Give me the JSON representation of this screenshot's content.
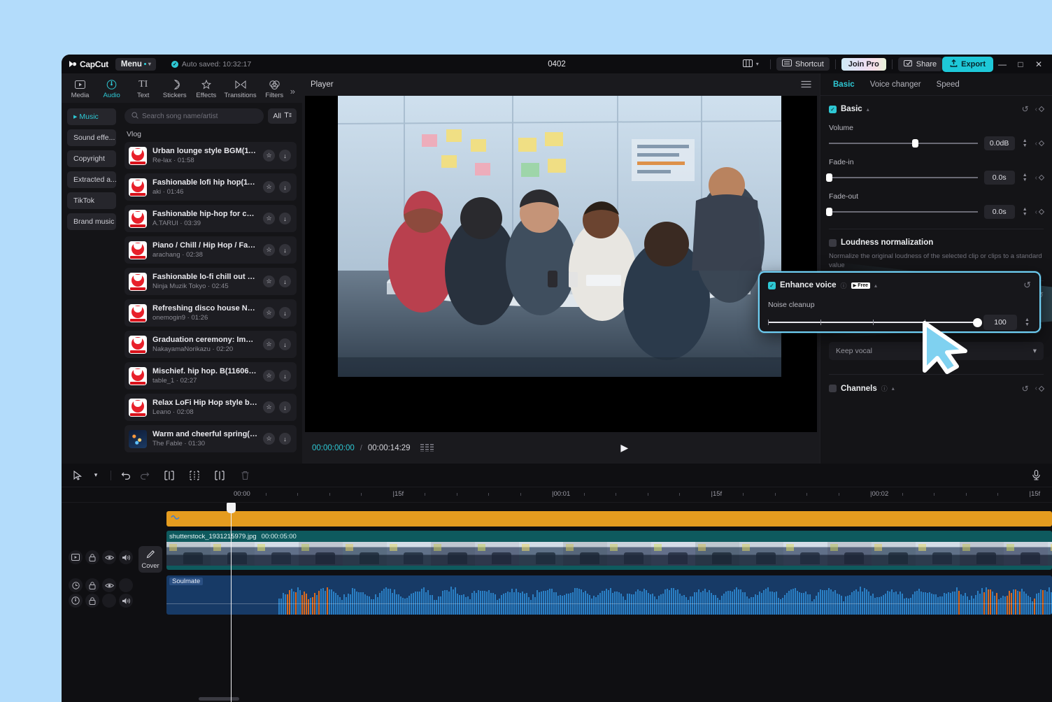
{
  "titlebar": {
    "app_name": "CapCut",
    "menu_label": "Menu",
    "autosave": "Auto saved: 10:32:17",
    "project_title": "0402",
    "shortcut_label": "Shortcut",
    "join_pro_label": "Join Pro",
    "share_label": "Share",
    "export_label": "Export",
    "minimize": "—",
    "maximize": "□",
    "close": "✕",
    "accent": "#1ec8d8"
  },
  "left_panel": {
    "tabs": [
      {
        "label": "Media",
        "icon": "media-icon"
      },
      {
        "label": "Audio",
        "icon": "audio-icon"
      },
      {
        "label": "Text",
        "icon": "text-icon"
      },
      {
        "label": "Stickers",
        "icon": "stickers-icon"
      },
      {
        "label": "Effects",
        "icon": "effects-icon"
      },
      {
        "label": "Transitions",
        "icon": "transitions-icon"
      },
      {
        "label": "Filters",
        "icon": "filters-icon"
      }
    ],
    "more_label": "»",
    "categories": [
      {
        "label": "Music",
        "active": true
      },
      {
        "label": "Sound effe...",
        "active": false
      },
      {
        "label": "Copyright",
        "active": false
      },
      {
        "label": "Extracted a...",
        "active": false
      },
      {
        "label": "TikTok",
        "active": false
      },
      {
        "label": "Brand music",
        "active": false
      }
    ],
    "search_placeholder": "Search song name/artist",
    "filter_label": "All",
    "section_title": "Vlog",
    "songs": [
      {
        "name": "Urban lounge style BGM(114...",
        "artist": "Re-lax",
        "duration": "01:58"
      },
      {
        "name": "Fashionable lofi hip hop(116...",
        "artist": "aki",
        "duration": "01:46"
      },
      {
        "name": "Fashionable hip-hop for com...",
        "artist": "A.TARUI",
        "duration": "03:39"
      },
      {
        "name": "Piano / Chill / Hip Hop / Fas...",
        "artist": "arachang",
        "duration": "02:38"
      },
      {
        "name": "Fashionable lo-fi chill out R ...",
        "artist": "Ninja Muzik Tokyo",
        "duration": "02:45"
      },
      {
        "name": "Refreshing disco house Nori ...",
        "artist": "onemogin9",
        "duration": "01:26"
      },
      {
        "name": "Graduation ceremony: Impre...",
        "artist": "NakayamaNorikazu",
        "duration": "02:20"
      },
      {
        "name": "Mischief. hip hop. B(1160627)",
        "artist": "table_1",
        "duration": "02:27"
      },
      {
        "name": "Relax LoFi Hip Hop style bea...",
        "artist": "Leano",
        "duration": "02:08"
      },
      {
        "name": "Warm and cheerful spring(14...",
        "artist": "The Fable",
        "duration": "01:30"
      }
    ]
  },
  "player": {
    "title": "Player",
    "current_time": "00:00:00:00",
    "separator": "/",
    "total_time": "00:00:14:29",
    "play_icon": "▶"
  },
  "right_panel": {
    "tabs": [
      {
        "label": "Basic",
        "active": true
      },
      {
        "label": "Voice changer",
        "active": false
      },
      {
        "label": "Speed",
        "active": false
      }
    ],
    "basic_group": {
      "title": "Basic",
      "checked": true,
      "params": [
        {
          "label": "Volume",
          "value": "0.0dB",
          "percent": 58
        },
        {
          "label": "Fade-in",
          "value": "0.0s",
          "percent": 0
        },
        {
          "label": "Fade-out",
          "value": "0.0s",
          "percent": 0
        }
      ]
    },
    "loudness": {
      "title": "Loudness normalization",
      "checked": false,
      "hint": "Normalize the original loudness of the selected clip or clips to a standard value"
    },
    "enhance_voice": {
      "title": "Enhance voice",
      "checked": true,
      "badge": "Free",
      "param_label": "Noise cleanup"
    },
    "keep_vocal": {
      "label": "Keep vocal"
    },
    "channels": {
      "title": "Channels",
      "checked": false
    }
  },
  "callout": {
    "title": "Enhance voice",
    "badge": "Free",
    "checked": true,
    "param_label": "Noise cleanup",
    "value": "100",
    "percent": 100,
    "border_color": "#6fd0f5"
  },
  "timeline": {
    "tools": [
      {
        "name": "select-tool",
        "glyph": "➤"
      },
      {
        "name": "select-dropdown",
        "glyph": "∨"
      },
      {
        "name": "undo",
        "glyph": "↶"
      },
      {
        "name": "redo",
        "glyph": "↷"
      },
      {
        "name": "split",
        "glyph": "]["
      },
      {
        "name": "trim-left",
        "glyph": "]["
      },
      {
        "name": "trim-right",
        "glyph": "]["
      },
      {
        "name": "delete",
        "glyph": "Ὕ1"
      }
    ],
    "mic_label": "mic-icon",
    "ruler_labels": [
      "00:00",
      "15f",
      "00:01",
      "15f",
      "00:02",
      "15f"
    ],
    "cover_label": "Cover",
    "video_clip": {
      "name": "shutterstock_1931215979.jpg",
      "duration": "00:00:05:00"
    },
    "audio_clip": {
      "name": "Soulmate"
    }
  }
}
